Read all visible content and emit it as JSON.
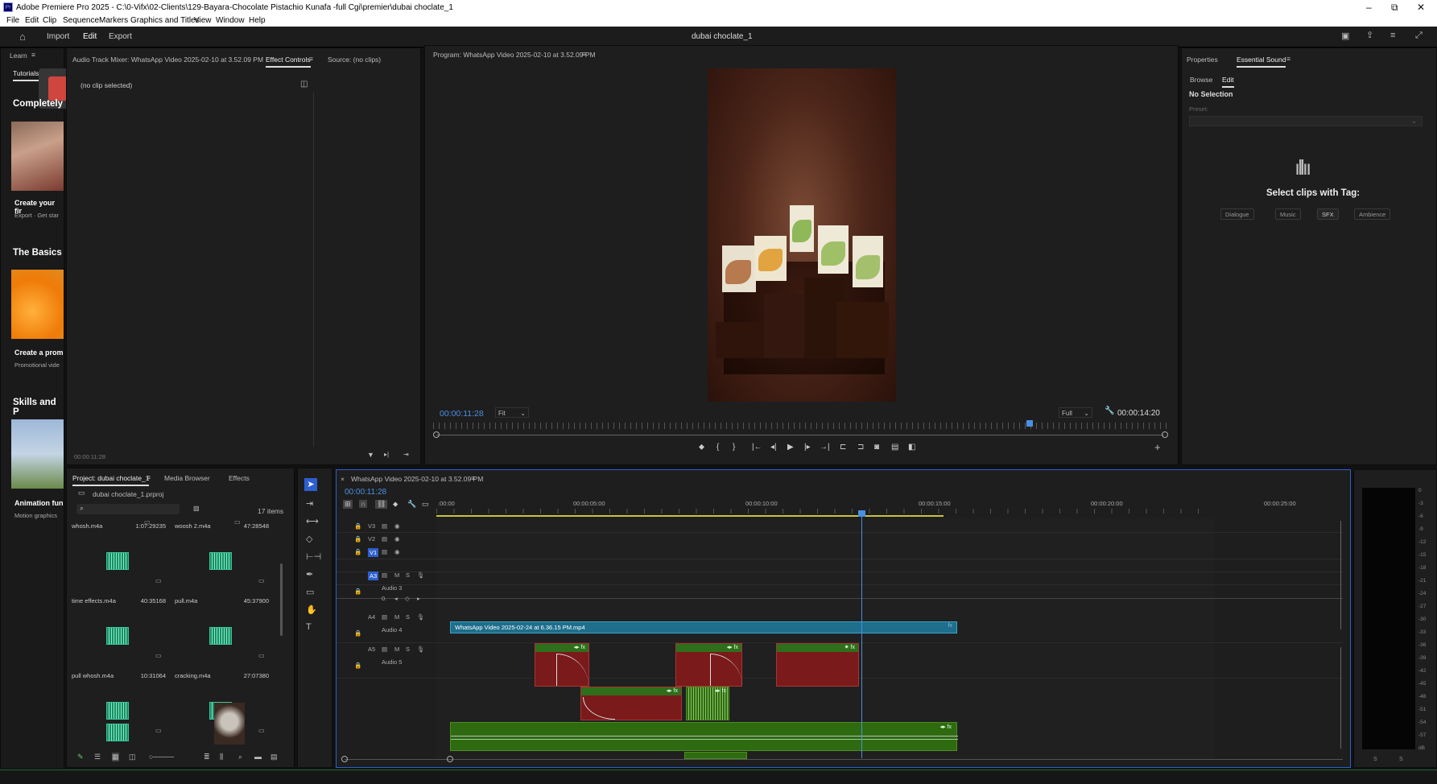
{
  "window": {
    "title": "Adobe Premiere Pro 2025 - C:\\0-Vifx\\02-Clients\\129-Bayara-Chocolate Pistachio Kunafa -full Cgi\\premier\\dubai choclate_1",
    "min": "–",
    "max": "⧉",
    "close": "✕"
  },
  "menu": [
    "File",
    "Edit",
    "Clip",
    "Sequence",
    "Markers",
    "Graphics and Titles",
    "View",
    "Window",
    "Help"
  ],
  "workspace": {
    "tabs": [
      "Import",
      "Edit",
      "Export"
    ],
    "active": "Edit",
    "project_title": "dubai choclate_1"
  },
  "learn": {
    "tab": "Learn",
    "subtab": "Tutorials",
    "heading1": "Completely",
    "card1_title": "Create your fir",
    "card1_sub": "Export · Get star",
    "heading2": "The Basics",
    "card2_title": "Create a prom",
    "card2_sub": "Promotional vide",
    "heading3": "Skills and P",
    "card3_title": "Animation fun",
    "card3_sub": "Motion graphics"
  },
  "source_panel": {
    "tabs": [
      "Audio Track Mixer: WhatsApp Video 2025-02-10 at 3.52.09 PM",
      "Effect Controls",
      "Source: (no clips)"
    ],
    "active": "Effect Controls",
    "no_clip": "(no clip selected)",
    "timecode": "00:00:11:28"
  },
  "program": {
    "title": "Program: WhatsApp Video 2025-02-10 at 3.52.09 PM",
    "timecode": "00:00:11:28",
    "fit": "Fit",
    "quality": "Full",
    "duration": "00:00:14:20",
    "playhead_fraction": 0.81
  },
  "essential": {
    "tabs": [
      "Properties",
      "Essential Sound"
    ],
    "active": "Essential Sound",
    "subtabs": [
      "Browse",
      "Edit"
    ],
    "active_sub": "Edit",
    "no_selection": "No Selection",
    "preset_label": "Preset:",
    "heading": "Select clips with Tag:",
    "tags": [
      "Dialogue",
      "Music",
      "SFX",
      "Ambience"
    ]
  },
  "project": {
    "tabs": [
      "Project: dubai choclate_1",
      "Media Browser",
      "Effects"
    ],
    "file": "dubai choclate_1.prproj",
    "count": "17 items",
    "items": [
      {
        "name": "whosh.m4a",
        "dur": "1:07:29235"
      },
      {
        "name": "woosh 2.m4a",
        "dur": "47:28548"
      },
      {
        "name": "time effects.m4a",
        "dur": "40:35168"
      },
      {
        "name": "pull.m4a",
        "dur": "45:37900"
      },
      {
        "name": "pull whosh.m4a",
        "dur": "10:31064"
      },
      {
        "name": "cracking.m4a",
        "dur": "27:07380"
      }
    ]
  },
  "timeline": {
    "title": "WhatsApp Video 2025-02-10 at 3.52.09 PM",
    "timecode": "00:00:11:28",
    "ruler": [
      ":00:00",
      "00:00:05:00",
      "00:00:10:00",
      "00:00:15:00",
      "00:00:20:00",
      "00:00:25:00"
    ],
    "tracks": [
      {
        "id": "V3",
        "name": ""
      },
      {
        "id": "V2",
        "name": ""
      },
      {
        "id": "V1",
        "name": ""
      },
      {
        "id": "A3",
        "name": "Audio 3"
      },
      {
        "id": "A4",
        "name": "Audio 4"
      },
      {
        "id": "A5",
        "name": "Audio 5"
      }
    ],
    "video_clip": "WhatsApp Video 2025-02-24 at 6.36.15 PM.mp4",
    "track_btn_m": "M",
    "track_btn_s": "S",
    "vol": "0."
  },
  "meter": {
    "labels": [
      "0",
      "-3",
      "-6",
      "-9",
      "-12",
      "-15",
      "-18",
      "-21",
      "-24",
      "-27",
      "-30",
      "-33",
      "-36",
      "-39",
      "-42",
      "-45",
      "-48",
      "-51",
      "-54",
      "-57",
      "dB"
    ],
    "sl": "S",
    "sr": "S"
  }
}
